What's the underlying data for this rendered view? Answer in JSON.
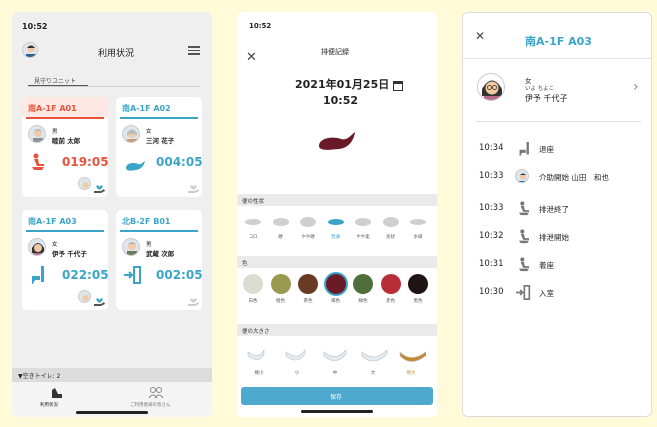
{
  "status_time": "10:52",
  "usage": {
    "title": "利用状況",
    "tab": "見守りユニット",
    "cards": [
      {
        "room": "南A-1F A01",
        "gender": "男",
        "name": "睦前 太郎",
        "time": "019:05",
        "alert": true
      },
      {
        "room": "南A-1F A02",
        "gender": "女",
        "name": "三河 花子",
        "time": "004:05",
        "alert": false
      },
      {
        "room": "南A-1F A03",
        "gender": "女",
        "name": "伊予 千代子",
        "time": "022:05",
        "alert": false
      },
      {
        "room": "北B-2F B01",
        "gender": "男",
        "name": "武蔵 次郎",
        "time": "002:05",
        "alert": false
      }
    ],
    "vacancy": "▼空きトイレ: 2",
    "nav": [
      {
        "label": "利用状況"
      },
      {
        "label": "ご利用者様の皆さん"
      }
    ]
  },
  "record": {
    "title": "排便記録",
    "date": "2021年01月25日",
    "time": "10:52",
    "shape_section": "便の性状",
    "shapes": [
      "コロ",
      "硬",
      "やや硬",
      "普通",
      "やや柔",
      "泥状",
      "水様"
    ],
    "selected_shape": "普通",
    "color_section": "色",
    "colors": [
      {
        "label": "白色",
        "hex": "#dcdcd2"
      },
      {
        "label": "橙色",
        "hex": "#9a9a4e"
      },
      {
        "label": "茶色",
        "hex": "#6a3b24"
      },
      {
        "label": "褐色",
        "hex": "#6a1a26"
      },
      {
        "label": "緑色",
        "hex": "#4e6e3c"
      },
      {
        "label": "赤色",
        "hex": "#b82e38"
      },
      {
        "label": "黒色",
        "hex": "#1e1414"
      }
    ],
    "selected_color": "褐色",
    "size_section": "便の大きさ",
    "sizes": [
      "極小",
      "小",
      "中",
      "大",
      "極大"
    ],
    "selected_size": "極大",
    "save": "保存"
  },
  "detail": {
    "room": "南A-1F A03",
    "gender": "女",
    "kana": "いよ ちよこ",
    "name": "伊予 千代子",
    "log": [
      {
        "time": "10:34",
        "label": "退座"
      },
      {
        "time": "10:33",
        "label": "介助開始 山田　和也"
      },
      {
        "time": "10:33",
        "label": "排泄終了"
      },
      {
        "time": "10:32",
        "label": "排泄開始"
      },
      {
        "time": "10:31",
        "label": "着座"
      },
      {
        "time": "10:30",
        "label": "入室"
      }
    ]
  },
  "colors": {
    "accent": "#3aa5c8",
    "alert": "#e8523a",
    "card_alert_bg": "#fde8e4"
  }
}
